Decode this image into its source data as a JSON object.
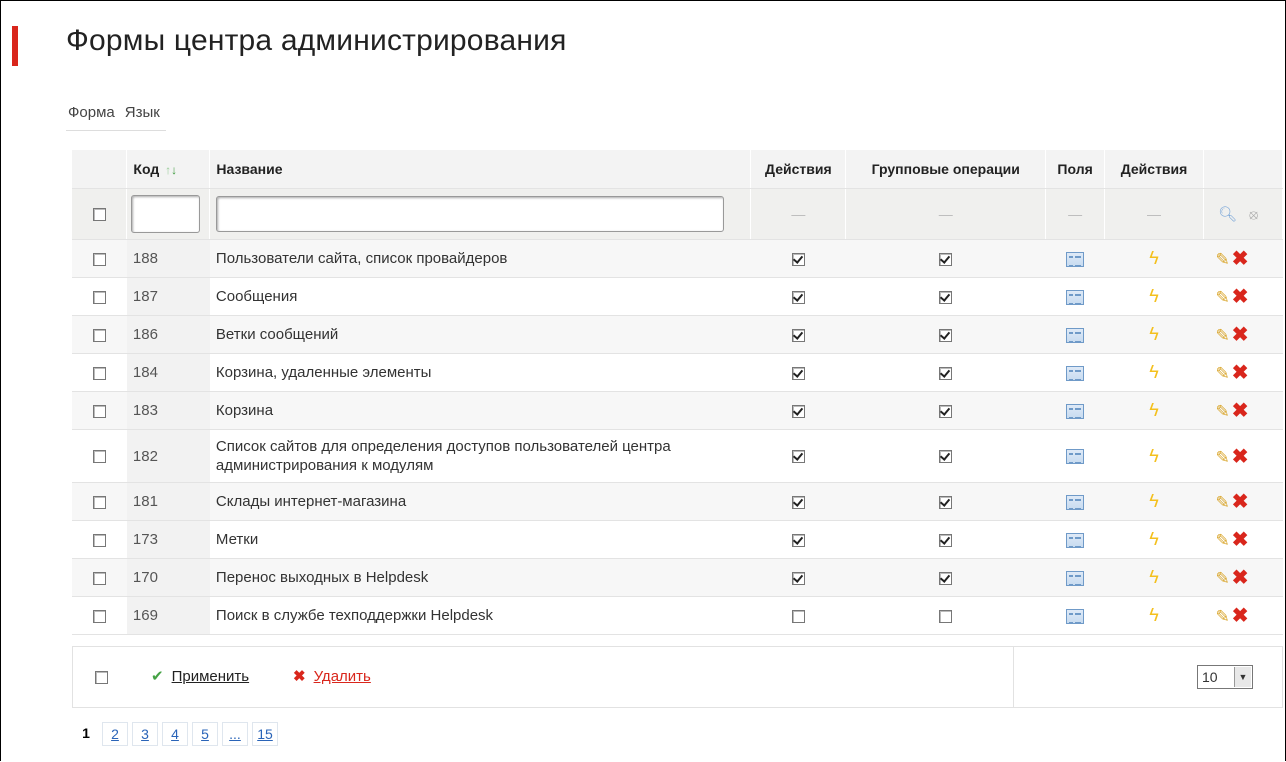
{
  "page": {
    "title": "Формы центра администрирования"
  },
  "menu": {
    "form": "Форма",
    "language": "Язык"
  },
  "table": {
    "headers": {
      "code": "Код",
      "name": "Название",
      "actions": "Действия",
      "group_ops": "Групповые операции",
      "fields": "Поля",
      "actions2": "Действия"
    },
    "filter_dash": "—",
    "rows": [
      {
        "code": "188",
        "name": "Пользователи сайта, список провайдеров",
        "actions": true,
        "group": true
      },
      {
        "code": "187",
        "name": "Сообщения",
        "actions": true,
        "group": true
      },
      {
        "code": "186",
        "name": "Ветки сообщений",
        "actions": true,
        "group": true
      },
      {
        "code": "184",
        "name": "Корзина, удаленные элементы",
        "actions": true,
        "group": true
      },
      {
        "code": "183",
        "name": "Корзина",
        "actions": true,
        "group": true
      },
      {
        "code": "182",
        "name": "Список сайтов для определения доступов пользователей центра администрирования к модулям",
        "actions": true,
        "group": true
      },
      {
        "code": "181",
        "name": "Склады интернет-магазина",
        "actions": true,
        "group": true
      },
      {
        "code": "173",
        "name": "Метки",
        "actions": true,
        "group": true
      },
      {
        "code": "170",
        "name": "Перенос выходных в Helpdesk",
        "actions": true,
        "group": true
      },
      {
        "code": "169",
        "name": "Поиск в службе техподдержки Helpdesk",
        "actions": false,
        "group": false
      }
    ]
  },
  "footer": {
    "apply": "Применить",
    "delete": "Удалить",
    "per_page": "10"
  },
  "pager": {
    "current": "1",
    "pages": [
      "2",
      "3",
      "4",
      "5",
      "...",
      "15"
    ]
  },
  "icons": {
    "fields": "list-form-icon",
    "actions": "lightning-icon",
    "edit": "pencil-icon",
    "delete": "red-x-icon",
    "search": "search-icon",
    "clear": "clear-icon"
  },
  "colors": {
    "accent": "#d9261c",
    "link": "#2a64b8",
    "apply_icon": "#45a245"
  }
}
